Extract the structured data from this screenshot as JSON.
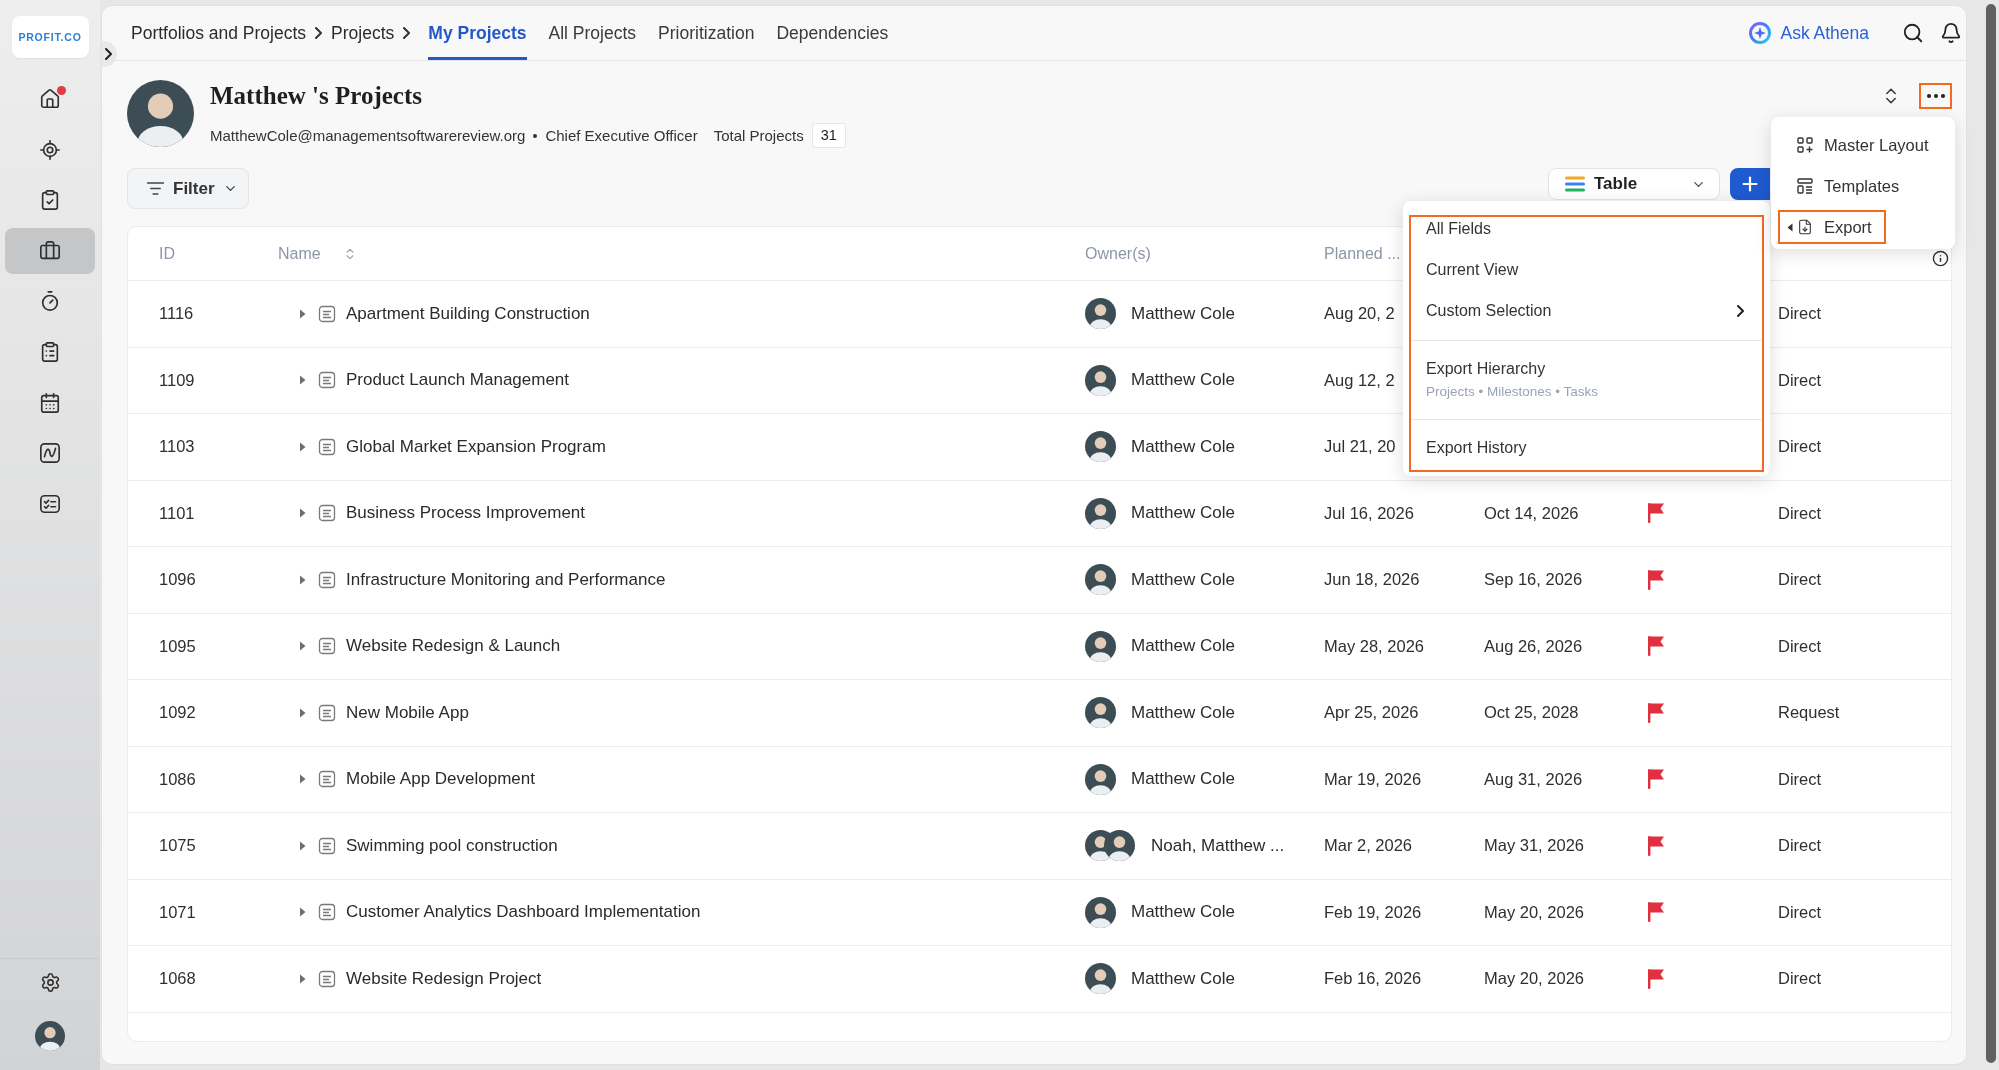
{
  "sidebar": {
    "logo": "PROFIT.CO",
    "items": [
      {
        "selected": false,
        "notification": true
      },
      {
        "selected": false,
        "notification": false
      },
      {
        "selected": false,
        "notification": false
      },
      {
        "selected": true,
        "notification": false
      },
      {
        "selected": false,
        "notification": false
      },
      {
        "selected": false,
        "notification": false
      },
      {
        "selected": false,
        "notification": false
      },
      {
        "selected": false,
        "notification": false
      },
      {
        "selected": false,
        "notification": false
      }
    ]
  },
  "nav": {
    "breadcrumb": [
      "Portfolios and Projects",
      "Projects"
    ],
    "tabs": [
      {
        "label": "My Projects",
        "selected": true
      },
      {
        "label": "All Projects",
        "selected": false
      },
      {
        "label": "Prioritization",
        "selected": false
      },
      {
        "label": "Dependencies",
        "selected": false
      }
    ],
    "assistant": "Ask Athena"
  },
  "profile": {
    "title": "Matthew 's Projects",
    "email": "MatthewCole@managementsoftwarereview.org",
    "role": "Chief Executive Officer",
    "total_label": "Total Projects",
    "total": "31",
    "more_button": {
      "highlighted": true
    }
  },
  "more_menu": {
    "items": [
      {
        "label": "Master Layout",
        "expanded": false,
        "highlighted": false
      },
      {
        "label": "Templates",
        "expanded": false,
        "highlighted": false
      },
      {
        "label": "Export",
        "expanded": true,
        "highlighted": true
      }
    ]
  },
  "toolbar": {
    "filter": "Filter",
    "view": "Table"
  },
  "export_menu": {
    "highlighted": true,
    "sections": [
      {
        "items": [
          {
            "label": "All Fields",
            "has_submenu": false
          },
          {
            "label": "Current View",
            "has_submenu": false
          },
          {
            "label": "Custom Selection",
            "has_submenu": true
          }
        ]
      },
      {
        "items": [
          {
            "label": "Export Hierarchy",
            "subtitle": "Projects • Milestones • Tasks",
            "has_submenu": false
          }
        ]
      },
      {
        "items": [
          {
            "label": "Export History",
            "has_submenu": false
          }
        ]
      }
    ]
  },
  "table": {
    "columns": [
      {
        "label": "ID",
        "sortable": false
      },
      {
        "label": "Name",
        "sortable": true
      },
      {
        "label": "Owner(s)",
        "sortable": false
      },
      {
        "label": "Planned ...",
        "sortable": false
      }
    ],
    "rows": [
      {
        "id": "1116",
        "name": "Apartment Building Construction",
        "owner": "Matthew Cole",
        "multiple_owners": false,
        "start": "Aug 20, 2",
        "source": "Direct"
      },
      {
        "id": "1109",
        "name": "Product Launch Management",
        "owner": "Matthew Cole",
        "multiple_owners": false,
        "start": "Aug 12, 2",
        "source": "Direct"
      },
      {
        "id": "1103",
        "name": "Global Market Expansion Program",
        "owner": "Matthew Cole",
        "multiple_owners": false,
        "start": "Jul 21, 20",
        "source": "Direct"
      },
      {
        "id": "1101",
        "name": "Business Process Improvement",
        "owner": "Matthew Cole",
        "multiple_owners": false,
        "start": "Jul 16, 2026",
        "end": "Oct 14, 2026",
        "flagged": true,
        "source": "Direct"
      },
      {
        "id": "1096",
        "name": "Infrastructure Monitoring and Performance",
        "owner": "Matthew Cole",
        "multiple_owners": false,
        "start": "Jun 18, 2026",
        "end": "Sep 16, 2026",
        "flagged": true,
        "source": "Direct"
      },
      {
        "id": "1095",
        "name": "Website Redesign & Launch",
        "owner": "Matthew Cole",
        "multiple_owners": false,
        "start": "May 28, 2026",
        "end": "Aug 26, 2026",
        "flagged": true,
        "source": "Direct"
      },
      {
        "id": "1092",
        "name": "New Mobile App",
        "owner": "Matthew Cole",
        "multiple_owners": false,
        "start": "Apr 25, 2026",
        "end": "Oct 25, 2028",
        "flagged": true,
        "source": "Request"
      },
      {
        "id": "1086",
        "name": "Mobile App Development",
        "owner": "Matthew Cole",
        "multiple_owners": false,
        "start": "Mar 19, 2026",
        "end": "Aug 31, 2026",
        "flagged": true,
        "source": "Direct"
      },
      {
        "id": "1075",
        "name": "Swimming pool construction",
        "owner": "Noah, Matthew ...",
        "multiple_owners": true,
        "start": "Mar 2, 2026",
        "end": "May 31, 2026",
        "flagged": true,
        "source": "Direct"
      },
      {
        "id": "1071",
        "name": "Customer Analytics Dashboard Implementation",
        "owner": "Matthew Cole",
        "multiple_owners": false,
        "start": "Feb 19, 2026",
        "end": "May 20, 2026",
        "flagged": true,
        "source": "Direct"
      },
      {
        "id": "1068",
        "name": "Website Redesign Project",
        "owner": "Matthew Cole",
        "multiple_owners": false,
        "start": "Feb 16, 2026",
        "end": "May 20, 2026",
        "flagged": true,
        "source": "Direct"
      }
    ]
  }
}
